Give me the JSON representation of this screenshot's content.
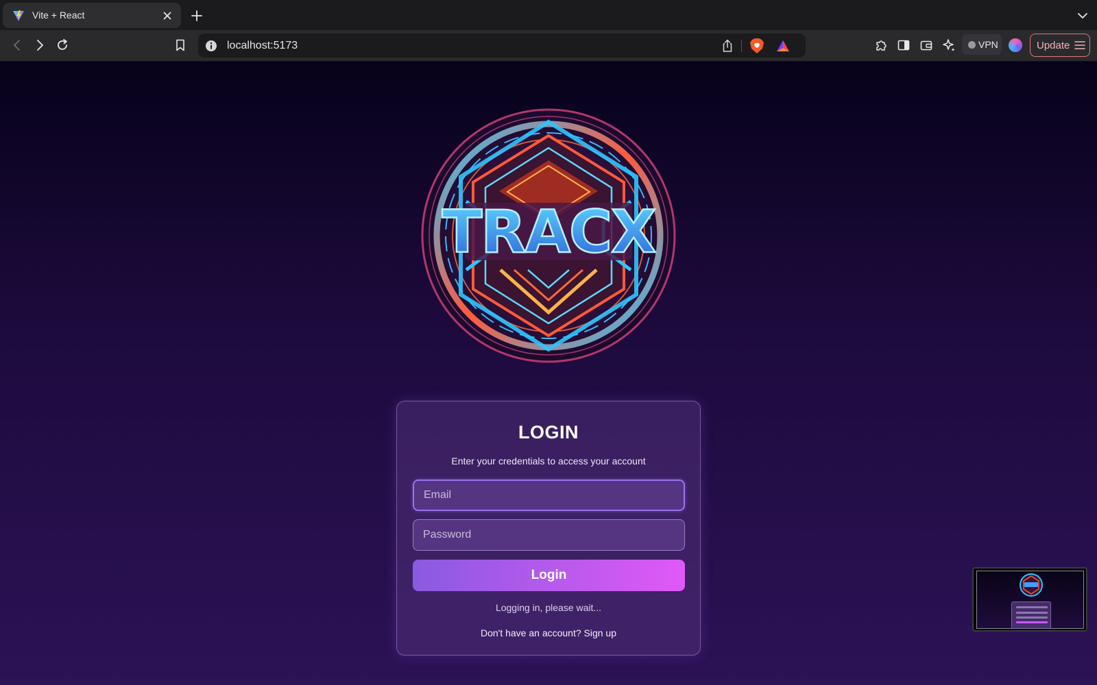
{
  "browser": {
    "tab_title": "Vite + React",
    "url": "localhost:5173",
    "vpn_label": "VPN",
    "update_label": "Update"
  },
  "logo": {
    "text": "TRACX"
  },
  "login": {
    "title": "LOGIN",
    "subtitle": "Enter your credentials to access your account",
    "email_placeholder": "Email",
    "email_value": "",
    "password_placeholder": "Password",
    "password_value": "",
    "button_label": "Login",
    "status": "Logging in, please wait...",
    "signup_prompt": "Don't have an account? Sign up"
  },
  "icons": {
    "favicon": "vite-icon",
    "tab_close": "close-icon",
    "new_tab": "plus-icon",
    "tab_menu": "chevron-down-icon",
    "back": "back-arrow-icon",
    "forward": "forward-arrow-icon",
    "reload": "reload-icon",
    "bookmark": "bookmark-icon",
    "site_info": "info-icon",
    "share": "share-icon",
    "brave_shields": "brave-lion-icon",
    "rewards": "bat-triangle-icon",
    "extensions": "puzzle-icon",
    "sidebar": "sidebar-icon",
    "wallet": "wallet-icon",
    "leo": "sparkle-icon",
    "profile": "profile-avatar",
    "menu": "hamburger-icon"
  },
  "colors": {
    "page_top": "#07021a",
    "page_bottom": "#2c1256",
    "button_start": "#8a5ae0",
    "button_end": "#e059f7",
    "input_focus_border": "#9a72ef",
    "update_border": "#e2757a"
  }
}
